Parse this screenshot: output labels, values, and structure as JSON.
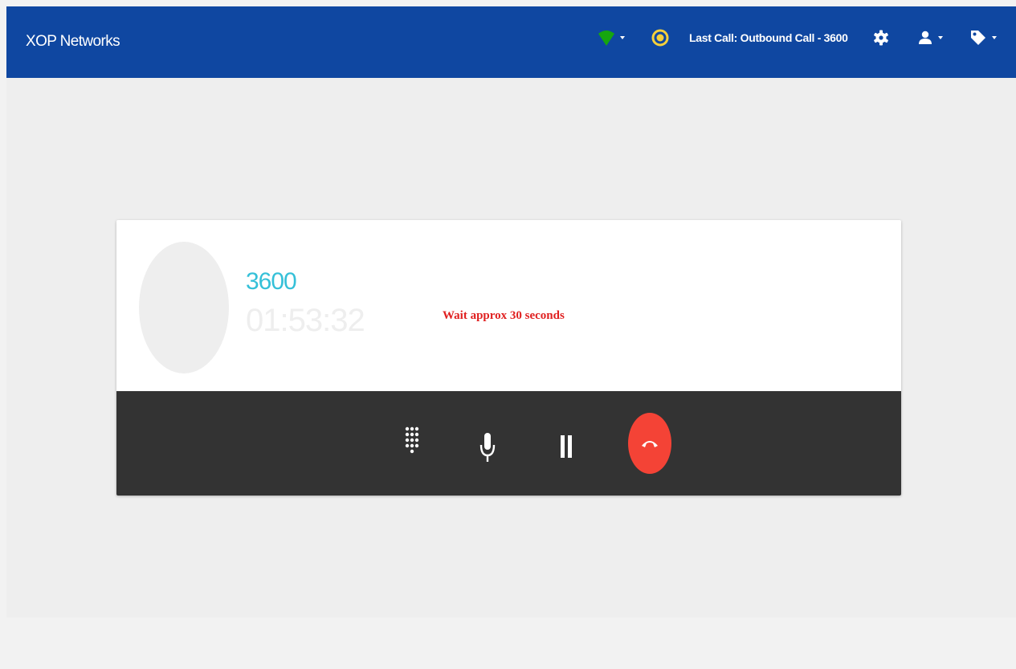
{
  "navbar": {
    "brand": "XOP Networks",
    "last_call": "Last Call: Outbound Call - 3600",
    "icons": [
      "wifi-signal-icon",
      "status-ring-icon",
      "gear-icon",
      "user-icon",
      "tag-icon"
    ],
    "colors": {
      "bar": "#0f47a1",
      "signal": "#16a60f",
      "status_ring": "#f5d03b"
    }
  },
  "call": {
    "number": "3600",
    "timer": "01:53:32",
    "status_message": "Wait approx 30 seconds"
  },
  "controls": {
    "icons": [
      "dialpad-icon",
      "microphone-icon",
      "pause-icon",
      "hangup-icon"
    ],
    "colors": {
      "bar": "#333333",
      "hangup": "#f44336"
    }
  }
}
